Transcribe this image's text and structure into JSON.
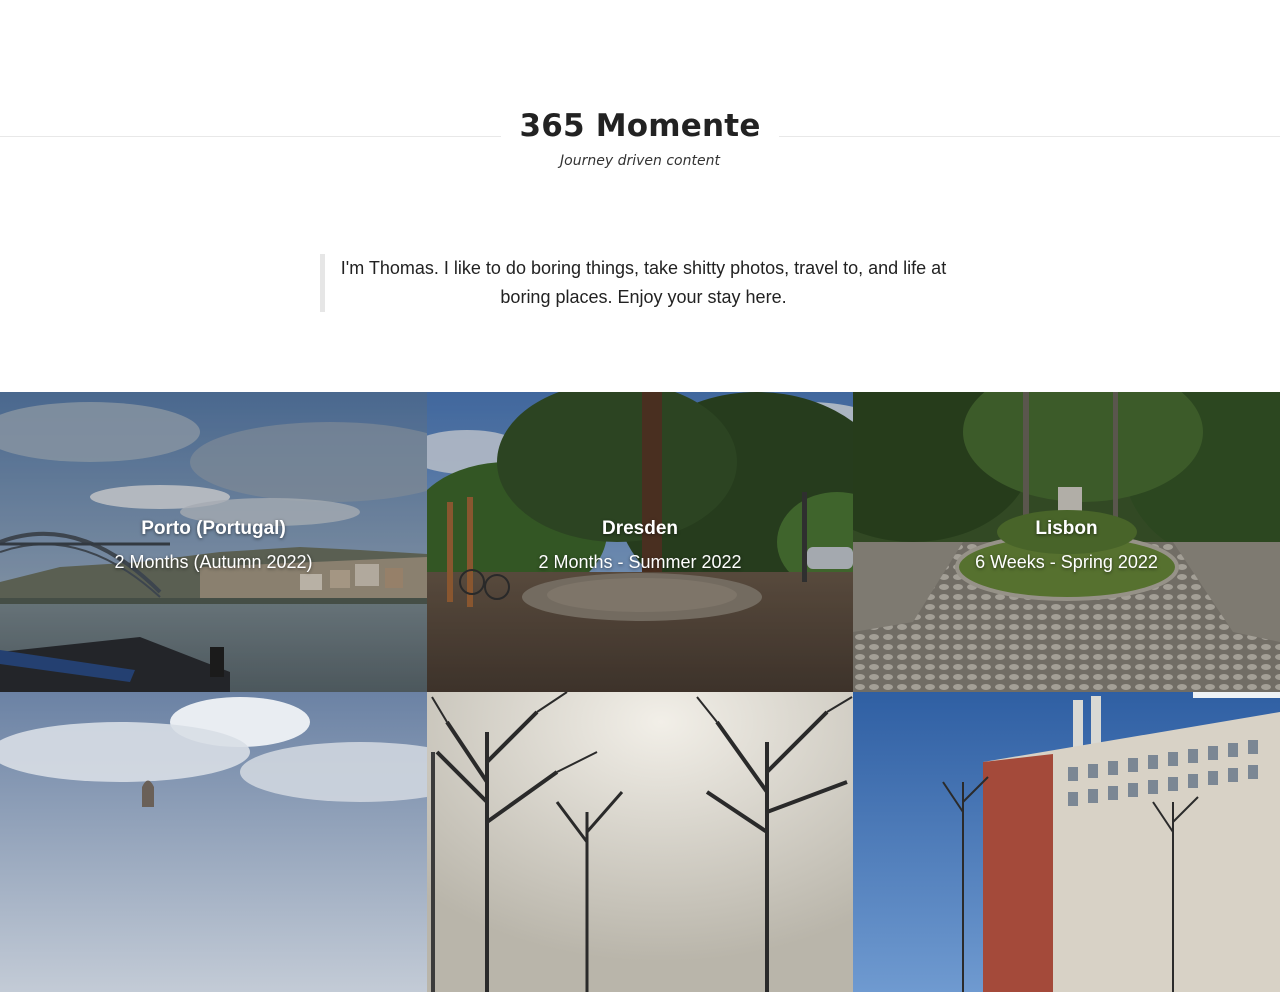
{
  "header": {
    "title": "365 Momente",
    "tagline": "Journey driven content"
  },
  "intro": {
    "text": "I'm Thomas. I like to do boring things, take shitty photos, travel to, and life at boring places. Enjoy your stay here."
  },
  "gallery": {
    "items": [
      {
        "place": "Porto (Portugal)",
        "period": "2 Months (Autumn 2022)",
        "scene": "river-bridge-photo"
      },
      {
        "place": "Dresden",
        "period": "2 Months - Summer 2022",
        "scene": "park-tree-photo"
      },
      {
        "place": "Lisbon",
        "period": "6 Weeks - Spring 2022",
        "scene": "garden-mosaic-photo"
      },
      {
        "place": "",
        "period": "",
        "scene": "cloudy-sky-dome-photo"
      },
      {
        "place": "",
        "period": "",
        "scene": "bare-trees-haze-photo"
      },
      {
        "place": "",
        "period": "",
        "scene": "industrial-building-photo"
      }
    ]
  }
}
